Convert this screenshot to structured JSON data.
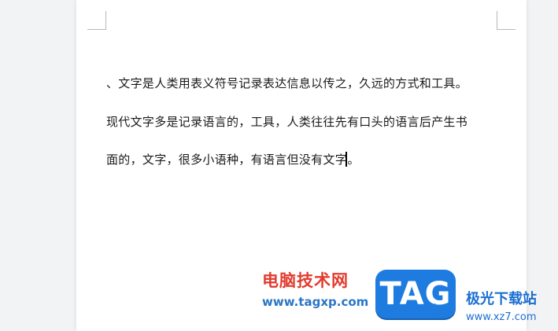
{
  "document": {
    "lines": [
      "、文字是人类用表义符号记录表达信息以传之，久远的方式和工具。",
      "现代文字多是记录语言的，工具，人类往往先有口头的语言后产生书",
      "面的，文字，很多小语种，有语言但没有文字"
    ],
    "line3_tail": "。"
  },
  "watermark": {
    "site_name": "电脑技术网",
    "site_url": "www.tagxp.com",
    "badge_text": "TAG",
    "partner_name": "极光下载站",
    "partner_url": "www.xz7.com"
  },
  "colors": {
    "canvas_bg": "#f2f3f5",
    "page_bg": "#ffffff",
    "text": "#1a1a1a",
    "watermark_red": "#e23b2e",
    "watermark_blue": "#2a76c6",
    "badge_blue": "#1e7be0"
  }
}
